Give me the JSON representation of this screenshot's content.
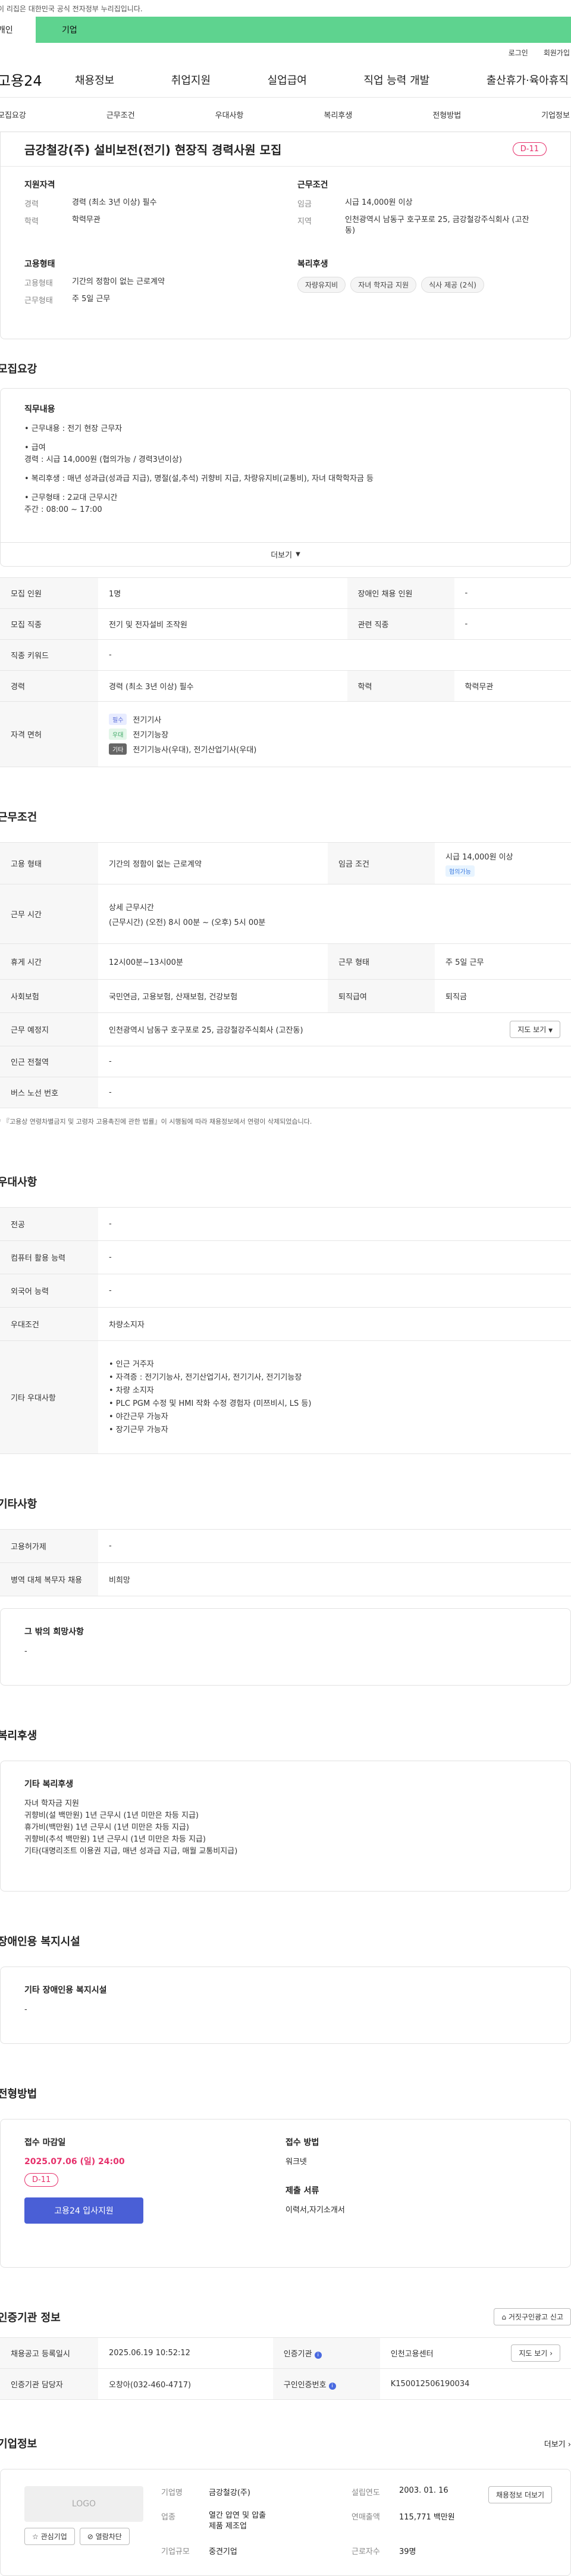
{
  "notice": "이 리집은 대한민국 공식 전자정부 누리집입니다.",
  "tabs": {
    "person": "개인",
    "company": "기업"
  },
  "util": [
    "로그인",
    "회원가입"
  ],
  "logo": "고용24",
  "gnb": [
    "채용정보",
    "취업지원",
    "실업급여",
    "직업 능력 개발",
    "출산휴가·육아휴직"
  ],
  "subnav": [
    "모집요강",
    "근무조건",
    "우대사항",
    "복리후생",
    "전형방법",
    "기업정보"
  ],
  "summary": {
    "title": "금강철강(주) 설비보전(전기) 현장직 경력사원 모집",
    "dday": "D-11",
    "qual_head": "지원자격",
    "qual": [
      {
        "k": "경력",
        "v": "경력 (최소 3년 이상) 필수"
      },
      {
        "k": "학력",
        "v": "학력무관"
      }
    ],
    "cond_head": "근무조건",
    "cond": [
      {
        "k": "임금",
        "v": "시급 14,000원 이상"
      },
      {
        "k": "지역",
        "v": "인천광역시 남동구 호구포로 25, 금강철강주식회사 (고잔동)"
      }
    ],
    "emp_head": "고용형태",
    "emp": [
      {
        "k": "고용형태",
        "v": "기간의 정함이 없는 근로계약"
      },
      {
        "k": "근무형태",
        "v": "주 5일 근무"
      }
    ],
    "welfare_head": "복리후생",
    "welfare": [
      "자량유지비",
      "자녀 학자금 지원",
      "식사 제공 (2식)"
    ]
  },
  "recruit": {
    "section": "모집요강",
    "box_title": "직무내용",
    "items": [
      "• 근무내용 : 전기 현장 근무자",
      "• 급여\n  경력 : 시급 14,000원 (협의가능 / 경력3년이상)",
      "• 복리후생 : 매년 성과급(성과급 지급), 명절(설,추석) 귀향비 지급, 차량유지비(교통비), 자녀 대학학자금 등",
      "• 근무형태 : 2교대 근무시간\n  주간 : 08:00 ~ 17:00"
    ],
    "more": "더보기",
    "table": {
      "r1": [
        "모집 인원",
        "1명",
        "장애인 채용 인원",
        "-"
      ],
      "r2": [
        "모집 직종",
        "전기 및 전자설비 조작원",
        "관련 직종",
        "-"
      ],
      "r3": [
        "직종 키워드",
        "-"
      ],
      "r4": [
        "경력",
        "경력 (최소 3년 이상) 필수",
        "학력",
        "학력무관"
      ],
      "lic_k": "자격 면허",
      "lic": [
        {
          "badge": "필수",
          "name": "전기기사"
        },
        {
          "badge": "우대",
          "name": "전기기능장"
        },
        {
          "badge": "기타",
          "name": "전기기능사(우대), 전기산업기사(우대)"
        }
      ]
    }
  },
  "work": {
    "section": "근무조건",
    "r1": [
      "고용 형태",
      "기간의 정함이 없는 근로계약",
      "임금 조건",
      "시급 14,000원 이상"
    ],
    "r1_pill": "협의가능",
    "r2_k": "근무 시간",
    "r2_title": "상세 근무시간",
    "r2_v": "(근무시간) (오전) 8시 00분 ~ (오후) 5시 00분",
    "r3": [
      "휴게 시간",
      "12시00분~13시00분",
      "근무 형태",
      "주 5일 근무"
    ],
    "r4": [
      "사회보험",
      "국민연금, 고용보험, 산재보험, 건강보험",
      "퇴직급여",
      "퇴직금"
    ],
    "r5": [
      "근무 예정지",
      "인천광역시 남동구 호구포로 25, 금강철강주식회사 (고잔동)"
    ],
    "map_btn": "지도 보기",
    "r6": [
      "인근 전철역",
      "-"
    ],
    "r7": [
      "버스 노선 번호",
      "-"
    ],
    "note": "* 『고용상 연령차별금지 및 고령자 고용촉진에 관한 법률』이 시행됨에 따라 채용정보에서 연령이 삭제되었습니다."
  },
  "pref": {
    "section": "우대사항",
    "r1": [
      "전공",
      "-"
    ],
    "r2": [
      "컴퓨터 활용 능력",
      "-"
    ],
    "r3": [
      "외국어 능력",
      "-"
    ],
    "r4": [
      "우대조건",
      "차량소지자"
    ],
    "r5_k": "기타 우대사항",
    "r5_items": [
      "• 인근 거주자",
      "• 자격증 : 전기기능사, 전기산업기사, 전기기사, 전기기능장",
      "• 차량 소지자",
      "• PLC PGM 수정 및 HMI 작화 수정 경험자 (미쯔비시, LS 등)",
      "• 야간근무 가능자",
      "• 장기근무 가능자"
    ]
  },
  "etc": {
    "section": "기타사항",
    "r1": [
      "고용허가제",
      "-"
    ],
    "r2": [
      "병역 대체 복무자 채용",
      "비희망"
    ],
    "box_title": "그 밖의 희망사항",
    "box_v": "-"
  },
  "welfare": {
    "section": "복리후생",
    "box_title": "기타 복리후생",
    "lines": [
      "자녀 학자금 지원",
      "귀향비(설 백만원) 1년 근무시 (1년 미만은 차등 지급)",
      "휴가비(백만원) 1년 근무시 (1년 미만은 차등 지급)",
      "귀향비(추석 백만원) 1년 근무시 (1년 미만은 차등 지급)",
      "기타(대명리조트 이용권 지급, 매년 성과급 지급, 매월 교통비지급)"
    ]
  },
  "disabled": {
    "section": "장애인용 복지시설",
    "box_title": "기타 장애인용 복지시설",
    "box_v": "-"
  },
  "process": {
    "section": "전형방법",
    "deadline_h": "접수 마감일",
    "deadline": "2025.07.06 (일) 24:00",
    "dday": "D-11",
    "apply": "고용24 입사지원",
    "method_h": "접수 방법",
    "method": "워크넷",
    "docs_h": "제출 서류",
    "docs": "이력서,자기소개서"
  },
  "agency": {
    "section": "인증기관 정보",
    "report_btn": "거짓구인광고 신고",
    "r1": [
      "채용공고 등록일시",
      "2025.06.19 10:52:12",
      "인증기관",
      "인천고용센터"
    ],
    "map_btn": "지도 보기",
    "r2": [
      "인증기관 담당자",
      "오창아(032-460-4717)",
      "구인인증번호",
      "K150012506190034"
    ]
  },
  "company": {
    "section": "기업정보",
    "more": "더보기",
    "logo": "LOGO",
    "fav": "관심기업",
    "follow": "열람차단",
    "rows": [
      [
        "기업명",
        "금강철강(주)",
        "설립연도",
        "2003. 01. 16"
      ],
      [
        "업종",
        "열간 압연 및 압출 제품 제조업",
        "연매출액",
        "115,771 백만원"
      ],
      [
        "기업규모",
        "중견기업",
        "근로자수",
        "39명"
      ]
    ],
    "info_btn": "채용정보 더보기"
  }
}
